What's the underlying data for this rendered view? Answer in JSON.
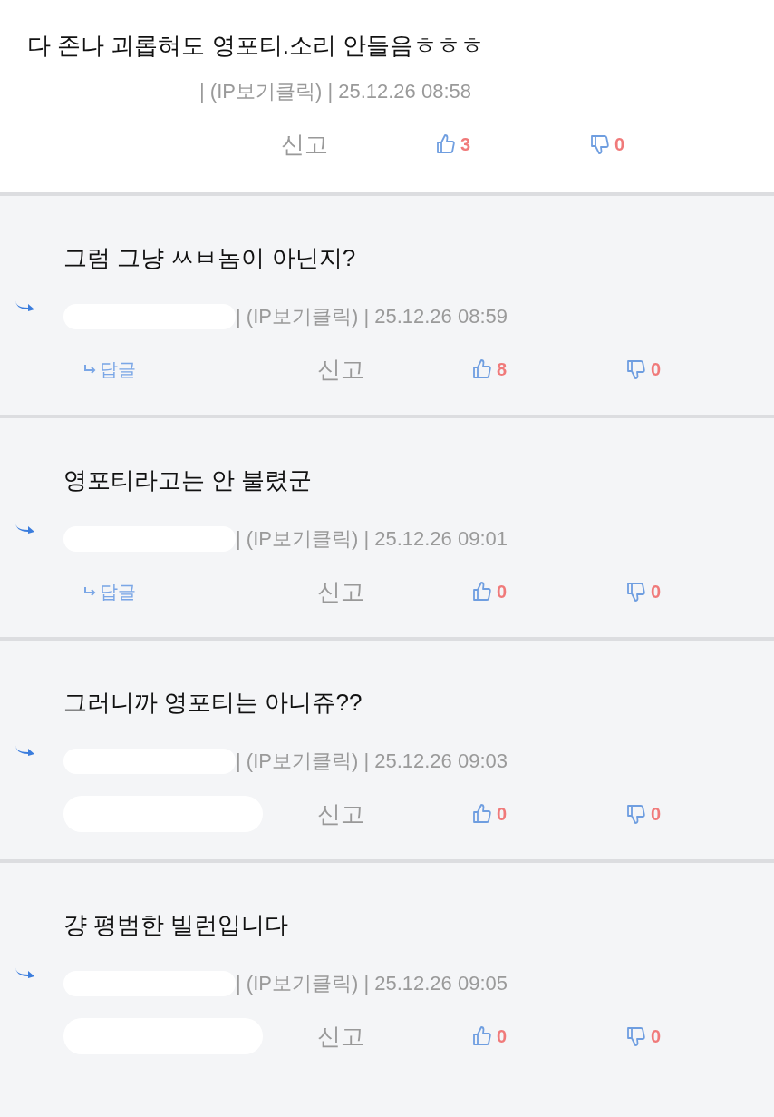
{
  "comments": [
    {
      "kind": "comment",
      "text": "다 존나 괴롭혀도 영포티.소리 안들음ㅎㅎㅎ",
      "meta": "| (IP보기클릭) | 25.12.26 08:58",
      "report": "신고",
      "likes": "3",
      "dislikes": "0"
    },
    {
      "kind": "reply",
      "text": "그럼 그냥 ㅆㅂ놈이 아닌지?",
      "meta": "| (IP보기클릭) | 25.12.26 08:59",
      "reply": "답글",
      "report": "신고",
      "likes": "8",
      "dislikes": "0"
    },
    {
      "kind": "reply",
      "text": "영포티라고는 안 불렸군",
      "meta": "| (IP보기클릭) | 25.12.26 09:01",
      "reply": "답글",
      "report": "신고",
      "likes": "0",
      "dislikes": "0"
    },
    {
      "kind": "reply",
      "text": "그러니까 영포티는 아니쥬??",
      "meta": "| (IP보기클릭) | 25.12.26 09:03",
      "report": "신고",
      "likes": "0",
      "dislikes": "0"
    },
    {
      "kind": "reply",
      "text": "걍 평범한 빌런입니다",
      "meta": "| (IP보기클릭) | 25.12.26 09:05",
      "report": "신고",
      "likes": "0",
      "dislikes": "0"
    }
  ]
}
